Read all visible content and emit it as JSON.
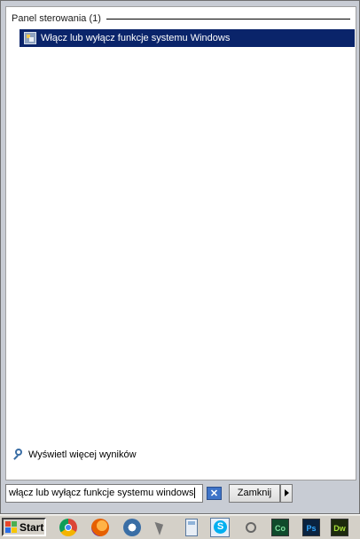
{
  "results": {
    "group_label": "Panel sterowania (1)",
    "items": [
      {
        "label": "Włącz lub wyłącz funkcje systemu Windows",
        "icon": "control-panel-icon"
      }
    ],
    "more_results_label": "Wyświetl więcej wyników"
  },
  "search": {
    "value": "włącz lub wyłącz funkcje systemu windows",
    "clear_icon": "close-icon"
  },
  "buttons": {
    "shutdown_label": "Zamknij",
    "shutdown_menu_icon": "triangle-right-icon"
  },
  "taskbar": {
    "start_label": "Start",
    "apps": [
      {
        "name": "chrome-icon"
      },
      {
        "name": "firefox-icon"
      },
      {
        "name": "thunderbird-icon"
      },
      {
        "name": "cursor-icon"
      },
      {
        "name": "calculator-icon"
      },
      {
        "name": "skype-icon",
        "text": "S"
      },
      {
        "name": "speaker-icon"
      },
      {
        "name": "co-icon",
        "text": "Co"
      },
      {
        "name": "photoshop-icon",
        "text": "Ps"
      },
      {
        "name": "dreamweaver-icon",
        "text": "Dw"
      }
    ]
  },
  "colors": {
    "selection": "#0a246a",
    "taskbar": "#d4d0c8"
  }
}
